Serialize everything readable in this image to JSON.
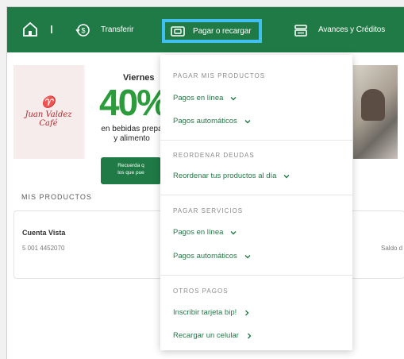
{
  "nav": {
    "transfer_label": "Transferir",
    "pagar_label": "Pagar o recargar",
    "avances_label": "Avances y Créditos",
    "accent": "#1f7a45",
    "highlight": "#3fc0f0",
    "icons": [
      "home-icon",
      "transfer-icon",
      "pay-icon",
      "credit-icon"
    ]
  },
  "banner": {
    "brand_line1": "Juan Valdez",
    "brand_line2": "Café",
    "day": "Viernes",
    "percent": "40%",
    "subtitle1": "en bebidas prepa",
    "subtitle2": "y alimento",
    "cta_line1": "Recuerda q",
    "cta_line2": "los que pue"
  },
  "products": {
    "section_title": "MIS PRODUCTOS",
    "account_name": "Cuenta Vista",
    "account_number": "5 001 4452070",
    "saldo_label": "Saldo d"
  },
  "dropdown": {
    "sections": [
      {
        "heading": "PAGAR MIS PRODUCTOS",
        "items": [
          {
            "label": "Pagos en línea",
            "chevron": "down"
          },
          {
            "label": "Pagos automáticos",
            "chevron": "down"
          }
        ]
      },
      {
        "heading": "REORDENAR DEUDAS",
        "items": [
          {
            "label": "Reordenar tus productos al día",
            "chevron": "down"
          }
        ]
      },
      {
        "heading": "PAGAR SERVICIOS",
        "items": [
          {
            "label": "Pagos en línea",
            "chevron": "down"
          },
          {
            "label": "Pagos automáticos",
            "chevron": "down"
          }
        ]
      },
      {
        "heading": "OTROS PAGOS",
        "items": [
          {
            "label": "Inscribir tarjeta bip!",
            "chevron": "right"
          },
          {
            "label": "Recargar un celular",
            "chevron": "right"
          }
        ]
      }
    ]
  }
}
